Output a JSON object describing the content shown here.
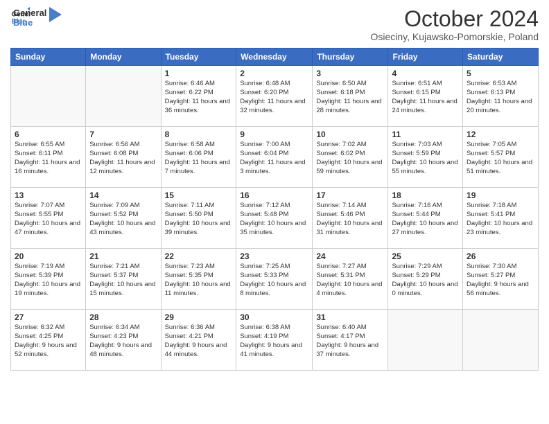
{
  "logo": {
    "line1": "General",
    "line2": "Blue"
  },
  "title": "October 2024",
  "subtitle": "Osieciny, Kujawsko-Pomorskie, Poland",
  "headers": [
    "Sunday",
    "Monday",
    "Tuesday",
    "Wednesday",
    "Thursday",
    "Friday",
    "Saturday"
  ],
  "weeks": [
    [
      {
        "day": "",
        "sunrise": "",
        "sunset": "",
        "daylight": ""
      },
      {
        "day": "",
        "sunrise": "",
        "sunset": "",
        "daylight": ""
      },
      {
        "day": "1",
        "sunrise": "Sunrise: 6:46 AM",
        "sunset": "Sunset: 6:22 PM",
        "daylight": "Daylight: 11 hours and 36 minutes."
      },
      {
        "day": "2",
        "sunrise": "Sunrise: 6:48 AM",
        "sunset": "Sunset: 6:20 PM",
        "daylight": "Daylight: 11 hours and 32 minutes."
      },
      {
        "day": "3",
        "sunrise": "Sunrise: 6:50 AM",
        "sunset": "Sunset: 6:18 PM",
        "daylight": "Daylight: 11 hours and 28 minutes."
      },
      {
        "day": "4",
        "sunrise": "Sunrise: 6:51 AM",
        "sunset": "Sunset: 6:15 PM",
        "daylight": "Daylight: 11 hours and 24 minutes."
      },
      {
        "day": "5",
        "sunrise": "Sunrise: 6:53 AM",
        "sunset": "Sunset: 6:13 PM",
        "daylight": "Daylight: 11 hours and 20 minutes."
      }
    ],
    [
      {
        "day": "6",
        "sunrise": "Sunrise: 6:55 AM",
        "sunset": "Sunset: 6:11 PM",
        "daylight": "Daylight: 11 hours and 16 minutes."
      },
      {
        "day": "7",
        "sunrise": "Sunrise: 6:56 AM",
        "sunset": "Sunset: 6:08 PM",
        "daylight": "Daylight: 11 hours and 12 minutes."
      },
      {
        "day": "8",
        "sunrise": "Sunrise: 6:58 AM",
        "sunset": "Sunset: 6:06 PM",
        "daylight": "Daylight: 11 hours and 7 minutes."
      },
      {
        "day": "9",
        "sunrise": "Sunrise: 7:00 AM",
        "sunset": "Sunset: 6:04 PM",
        "daylight": "Daylight: 11 hours and 3 minutes."
      },
      {
        "day": "10",
        "sunrise": "Sunrise: 7:02 AM",
        "sunset": "Sunset: 6:02 PM",
        "daylight": "Daylight: 10 hours and 59 minutes."
      },
      {
        "day": "11",
        "sunrise": "Sunrise: 7:03 AM",
        "sunset": "Sunset: 5:59 PM",
        "daylight": "Daylight: 10 hours and 55 minutes."
      },
      {
        "day": "12",
        "sunrise": "Sunrise: 7:05 AM",
        "sunset": "Sunset: 5:57 PM",
        "daylight": "Daylight: 10 hours and 51 minutes."
      }
    ],
    [
      {
        "day": "13",
        "sunrise": "Sunrise: 7:07 AM",
        "sunset": "Sunset: 5:55 PM",
        "daylight": "Daylight: 10 hours and 47 minutes."
      },
      {
        "day": "14",
        "sunrise": "Sunrise: 7:09 AM",
        "sunset": "Sunset: 5:52 PM",
        "daylight": "Daylight: 10 hours and 43 minutes."
      },
      {
        "day": "15",
        "sunrise": "Sunrise: 7:11 AM",
        "sunset": "Sunset: 5:50 PM",
        "daylight": "Daylight: 10 hours and 39 minutes."
      },
      {
        "day": "16",
        "sunrise": "Sunrise: 7:12 AM",
        "sunset": "Sunset: 5:48 PM",
        "daylight": "Daylight: 10 hours and 35 minutes."
      },
      {
        "day": "17",
        "sunrise": "Sunrise: 7:14 AM",
        "sunset": "Sunset: 5:46 PM",
        "daylight": "Daylight: 10 hours and 31 minutes."
      },
      {
        "day": "18",
        "sunrise": "Sunrise: 7:16 AM",
        "sunset": "Sunset: 5:44 PM",
        "daylight": "Daylight: 10 hours and 27 minutes."
      },
      {
        "day": "19",
        "sunrise": "Sunrise: 7:18 AM",
        "sunset": "Sunset: 5:41 PM",
        "daylight": "Daylight: 10 hours and 23 minutes."
      }
    ],
    [
      {
        "day": "20",
        "sunrise": "Sunrise: 7:19 AM",
        "sunset": "Sunset: 5:39 PM",
        "daylight": "Daylight: 10 hours and 19 minutes."
      },
      {
        "day": "21",
        "sunrise": "Sunrise: 7:21 AM",
        "sunset": "Sunset: 5:37 PM",
        "daylight": "Daylight: 10 hours and 15 minutes."
      },
      {
        "day": "22",
        "sunrise": "Sunrise: 7:23 AM",
        "sunset": "Sunset: 5:35 PM",
        "daylight": "Daylight: 10 hours and 11 minutes."
      },
      {
        "day": "23",
        "sunrise": "Sunrise: 7:25 AM",
        "sunset": "Sunset: 5:33 PM",
        "daylight": "Daylight: 10 hours and 8 minutes."
      },
      {
        "day": "24",
        "sunrise": "Sunrise: 7:27 AM",
        "sunset": "Sunset: 5:31 PM",
        "daylight": "Daylight: 10 hours and 4 minutes."
      },
      {
        "day": "25",
        "sunrise": "Sunrise: 7:29 AM",
        "sunset": "Sunset: 5:29 PM",
        "daylight": "Daylight: 10 hours and 0 minutes."
      },
      {
        "day": "26",
        "sunrise": "Sunrise: 7:30 AM",
        "sunset": "Sunset: 5:27 PM",
        "daylight": "Daylight: 9 hours and 56 minutes."
      }
    ],
    [
      {
        "day": "27",
        "sunrise": "Sunrise: 6:32 AM",
        "sunset": "Sunset: 4:25 PM",
        "daylight": "Daylight: 9 hours and 52 minutes."
      },
      {
        "day": "28",
        "sunrise": "Sunrise: 6:34 AM",
        "sunset": "Sunset: 4:23 PM",
        "daylight": "Daylight: 9 hours and 48 minutes."
      },
      {
        "day": "29",
        "sunrise": "Sunrise: 6:36 AM",
        "sunset": "Sunset: 4:21 PM",
        "daylight": "Daylight: 9 hours and 44 minutes."
      },
      {
        "day": "30",
        "sunrise": "Sunrise: 6:38 AM",
        "sunset": "Sunset: 4:19 PM",
        "daylight": "Daylight: 9 hours and 41 minutes."
      },
      {
        "day": "31",
        "sunrise": "Sunrise: 6:40 AM",
        "sunset": "Sunset: 4:17 PM",
        "daylight": "Daylight: 9 hours and 37 minutes."
      },
      {
        "day": "",
        "sunrise": "",
        "sunset": "",
        "daylight": ""
      },
      {
        "day": "",
        "sunrise": "",
        "sunset": "",
        "daylight": ""
      }
    ]
  ]
}
